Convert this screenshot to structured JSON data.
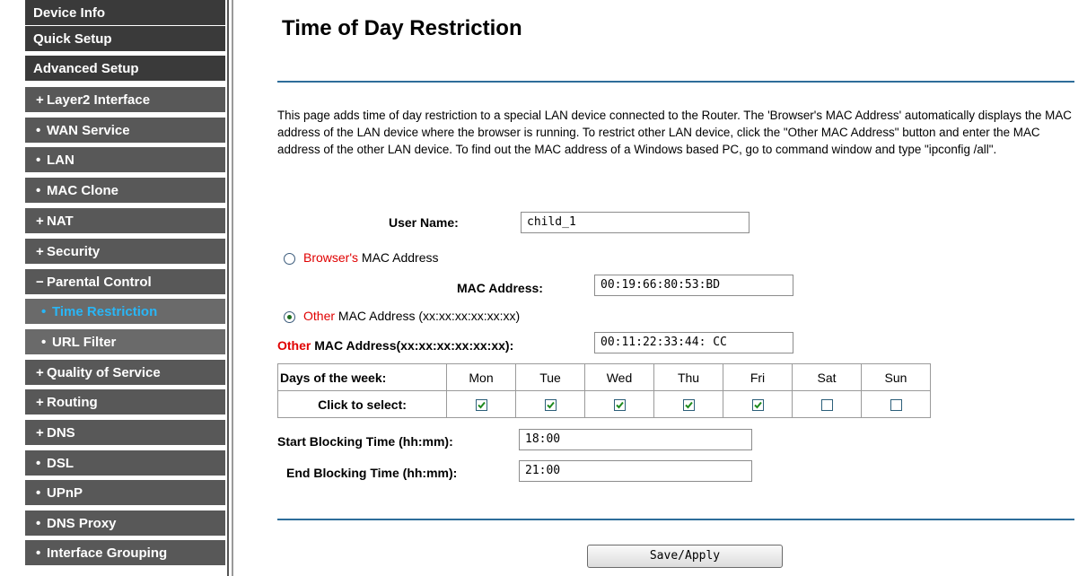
{
  "sidebar": {
    "items": [
      {
        "label": "Device Info",
        "level": "top",
        "marker": ""
      },
      {
        "label": "Quick Setup",
        "level": "top",
        "marker": ""
      },
      {
        "label": "Advanced Setup",
        "level": "top",
        "marker": ""
      },
      {
        "label": "Layer2 Interface",
        "level": "sub",
        "marker": "+"
      },
      {
        "label": "WAN Service",
        "level": "sub",
        "marker": "•"
      },
      {
        "label": "LAN",
        "level": "sub",
        "marker": "•"
      },
      {
        "label": "MAC Clone",
        "level": "sub",
        "marker": "•"
      },
      {
        "label": "NAT",
        "level": "sub",
        "marker": "+"
      },
      {
        "label": "Security",
        "level": "sub",
        "marker": "+"
      },
      {
        "label": "Parental Control",
        "level": "sub",
        "marker": "−"
      },
      {
        "label": "Time Restriction",
        "level": "sub2",
        "marker": "•",
        "active": true
      },
      {
        "label": "URL Filter",
        "level": "sub2",
        "marker": "•"
      },
      {
        "label": "Quality of Service",
        "level": "sub",
        "marker": "+"
      },
      {
        "label": "Routing",
        "level": "sub",
        "marker": "+"
      },
      {
        "label": "DNS",
        "level": "sub",
        "marker": "+"
      },
      {
        "label": "DSL",
        "level": "sub",
        "marker": "•"
      },
      {
        "label": "UPnP",
        "level": "sub",
        "marker": "•"
      },
      {
        "label": "DNS Proxy",
        "level": "sub",
        "marker": "•"
      },
      {
        "label": "Interface Grouping",
        "level": "sub",
        "marker": "•"
      }
    ]
  },
  "page": {
    "title": "Time of Day Restriction",
    "description": "This page adds time of day restriction to a special LAN device connected to the Router. The 'Browser's MAC Address' automatically displays the MAC address of the LAN device where the browser is running. To restrict other LAN device, click the \"Other MAC Address\" button and enter the MAC address of the other LAN device. To find out the MAC address of a Windows based PC, go to command window and type \"ipconfig /all\"."
  },
  "form": {
    "user_name_label": "User Name:",
    "user_name_value": "child_1",
    "browser_mac_option": {
      "red_part": "Browser's",
      "rest": " MAC Address",
      "selected": false
    },
    "mac_address_label": "MAC Address:",
    "mac_address_value": "00:19:66:80:53:BD",
    "other_mac_option": {
      "red_part": "Other",
      "rest": " MAC Address (xx:xx:xx:xx:xx:xx)",
      "selected": true
    },
    "other_mac_label": {
      "red_part": "Other",
      "rest": " MAC Address(xx:xx:xx:xx:xx:xx):"
    },
    "other_mac_value": "00:11:22:33:44: CC",
    "days_label": "Days of the week:",
    "click_label": "Click to select:",
    "days": [
      {
        "name": "Mon",
        "checked": true
      },
      {
        "name": "Tue",
        "checked": true
      },
      {
        "name": "Wed",
        "checked": true
      },
      {
        "name": "Thu",
        "checked": true
      },
      {
        "name": "Fri",
        "checked": true
      },
      {
        "name": "Sat",
        "checked": false
      },
      {
        "name": "Sun",
        "checked": false
      }
    ],
    "start_label": "Start Blocking Time (hh:mm):",
    "start_value": "18:00",
    "end_label": "End Blocking Time (hh:mm):",
    "end_value": "21:00",
    "save_label": "Save/Apply"
  }
}
